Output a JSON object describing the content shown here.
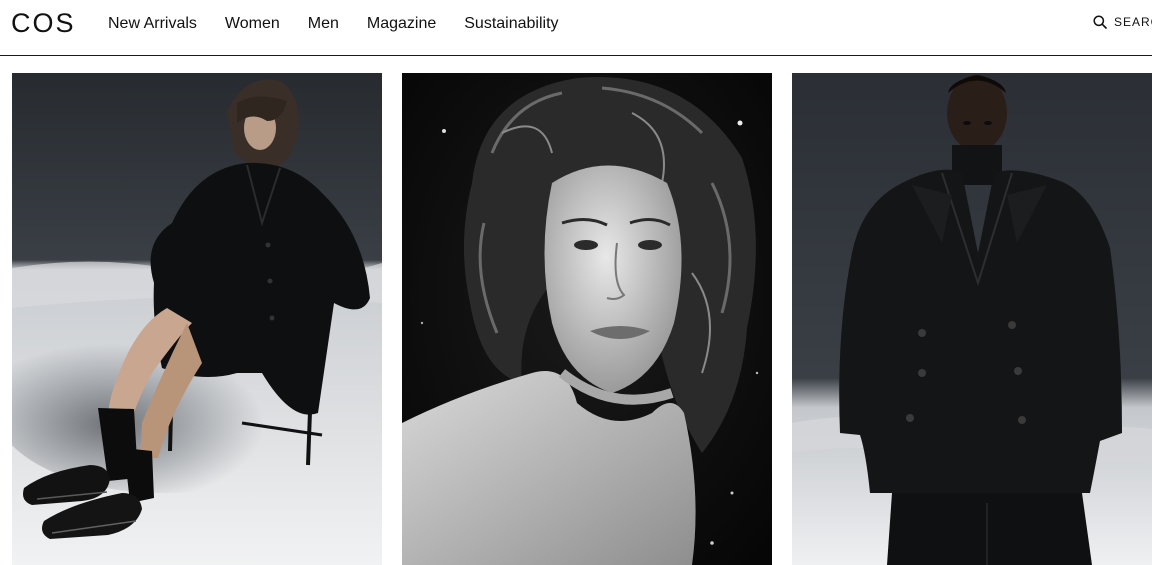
{
  "brand": {
    "logo_text": "COS"
  },
  "nav": {
    "items": [
      {
        "label": "New Arrivals"
      },
      {
        "label": "Women"
      },
      {
        "label": "Men"
      },
      {
        "label": "Magazine"
      },
      {
        "label": "Sustainability"
      }
    ]
  },
  "search": {
    "label": "SEARCH",
    "icon": "search-icon"
  },
  "gallery": {
    "tiles": [
      {
        "subject": "woman in black coat seated in snow",
        "icon": "image"
      },
      {
        "subject": "black and white portrait with curly hair",
        "icon": "image"
      },
      {
        "subject": "man in black double-breasted coat in snow",
        "icon": "image"
      }
    ]
  },
  "colors": {
    "text": "#111111",
    "background": "#ffffff",
    "divider": "#1a1a1a"
  }
}
